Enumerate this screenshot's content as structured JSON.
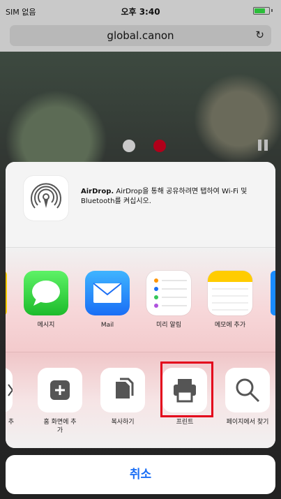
{
  "status_bar": {
    "carrier": "SIM 없음",
    "time": "오후 3:40"
  },
  "browser": {
    "url": "global.canon",
    "reload_icon": "reload-icon"
  },
  "page": {
    "carousel_colors": [
      "#c9c9c9",
      "#b0001a"
    ]
  },
  "share_sheet": {
    "airdrop": {
      "title": "AirDrop.",
      "description": "AirDrop을 통해 공유하려면 탭하여 Wi-Fi 및 Bluetooth를 켜십시오."
    },
    "apps": [
      {
        "label": "메시지",
        "icon": "messages-icon"
      },
      {
        "label": "Mail",
        "icon": "mail-icon"
      },
      {
        "label": "미리 알림",
        "icon": "reminders-icon"
      },
      {
        "label": "메모에 추가",
        "icon": "notes-icon"
      }
    ],
    "actions": [
      {
        "label": "기 추",
        "icon": "partial-icon"
      },
      {
        "label": "홈 화면에 추가",
        "icon": "add-to-home-icon"
      },
      {
        "label": "복사하기",
        "icon": "copy-icon"
      },
      {
        "label": "프린트",
        "icon": "print-icon"
      },
      {
        "label": "페이지에서 찾기",
        "icon": "find-in-page-icon"
      }
    ],
    "cancel_label": "취소"
  },
  "colors": {
    "highlight": "#e3001b",
    "accent": "#1a6ef5"
  }
}
